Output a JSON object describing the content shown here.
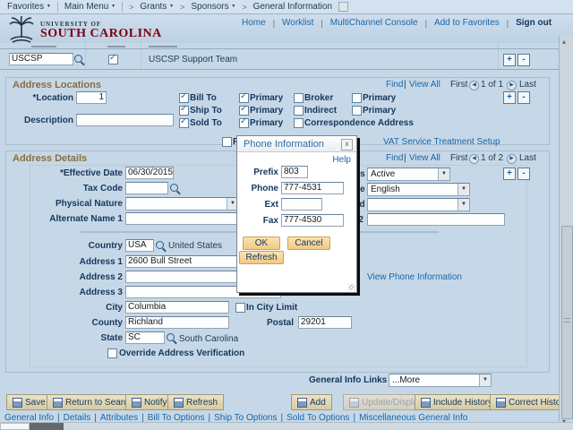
{
  "breadcrumb": {
    "favorites": "Favorites",
    "main_menu": "Main Menu",
    "grants": "Grants",
    "sponsors": "Sponsors",
    "current": "General Information",
    "sep": ">"
  },
  "topnav": {
    "home": "Home",
    "worklist": "Worklist",
    "multichannel": "MultiChannel Console",
    "add_to_favorites": "Add to Favorites",
    "sign_out": "Sign out",
    "divider": "|"
  },
  "logo": {
    "line1": "UNIVERSITY OF",
    "line2": "SOUTH CAROLINA"
  },
  "sponsor_row": {
    "id_value": "USCSP",
    "description": "USCSP Support Team",
    "plus": "+",
    "minus": "-"
  },
  "paging": {
    "find": "Find",
    "view_all": "View All",
    "divider": "|",
    "first": "First",
    "last": "Last"
  },
  "address_locations": {
    "title": "Address Locations",
    "page": "1 of 1",
    "location_label": "*Location",
    "location_value": "1",
    "description_label": "Description",
    "checks_col1": [
      {
        "label": "Bill To"
      },
      {
        "label": "Ship To"
      },
      {
        "label": "Sold To"
      }
    ],
    "checks_col2": [
      {
        "label": "Primary"
      },
      {
        "label": "Primary"
      },
      {
        "label": "Primary"
      }
    ],
    "checks_col3": [
      {
        "label": "Broker"
      },
      {
        "label": "Indirect"
      },
      {
        "label": "Correspondence Address"
      }
    ],
    "checks_col4": [
      {
        "label": "Primary"
      },
      {
        "label": "Primary"
      }
    ]
  },
  "vat_row": {
    "clipped_label": "R",
    "vat_link": "VAT Service Treatment Setup"
  },
  "address_details": {
    "title": "Address Details",
    "page": "1 of 2",
    "effective_date_label": "*Effective Date",
    "effective_date": "06/30/2015",
    "tax_code_label": "Tax Code",
    "physical_nature_label": "Physical Nature",
    "alternate_name1_label": "Alternate Name 1",
    "status_label_fragment": "us",
    "status_value": "Active",
    "language_label_fragment": "de",
    "language_value": "English",
    "clipped_label_fragment": "ed",
    "name2_label_fragment": "e 2",
    "country_label": "Country",
    "country_code": "USA",
    "country_name": "United States",
    "address1_label": "Address 1",
    "address1": "2600 Bull Street",
    "address2_label": "Address 2",
    "address3_label": "Address 3",
    "city_label": "City",
    "city": "Columbia",
    "in_city_limit_label": "In City Limit",
    "county_label": "County",
    "county": "Richland",
    "postal_label": "Postal",
    "postal": "29201",
    "state_label": "State",
    "state_code": "SC",
    "state_name": "South Carolina",
    "override_label": "Override Address Verification",
    "view_phone_link": "View Phone Information"
  },
  "phone_dialog": {
    "title": "Phone Information",
    "close": "x",
    "help": "Help",
    "prefix_label": "Prefix",
    "prefix": "803",
    "phone_label": "Phone",
    "phone": "777-4531",
    "ext_label": "Ext",
    "ext": "",
    "fax_label": "Fax",
    "fax": "777-4530",
    "ok": "OK",
    "cancel": "Cancel",
    "refresh": "Refresh"
  },
  "footer": {
    "general_info_links_label": "General Info Links",
    "general_info_links_value": "...More",
    "buttons_left": [
      "Save",
      "Return to Search",
      "Notify",
      "Refresh"
    ],
    "buttons_right": [
      "Add",
      "Update/Display",
      "Include History",
      "Correct History"
    ],
    "links": [
      "General Info",
      "Details",
      "Attributes",
      "Bill To Options",
      "Ship To Options",
      "Sold To Options",
      "Miscellaneous General Info"
    ],
    "divider": "|"
  },
  "colors": {
    "garnet": "#7a0014",
    "navy": "#16365c",
    "link_blue": "#1a66a8",
    "section_brown": "#8a6d3f"
  }
}
